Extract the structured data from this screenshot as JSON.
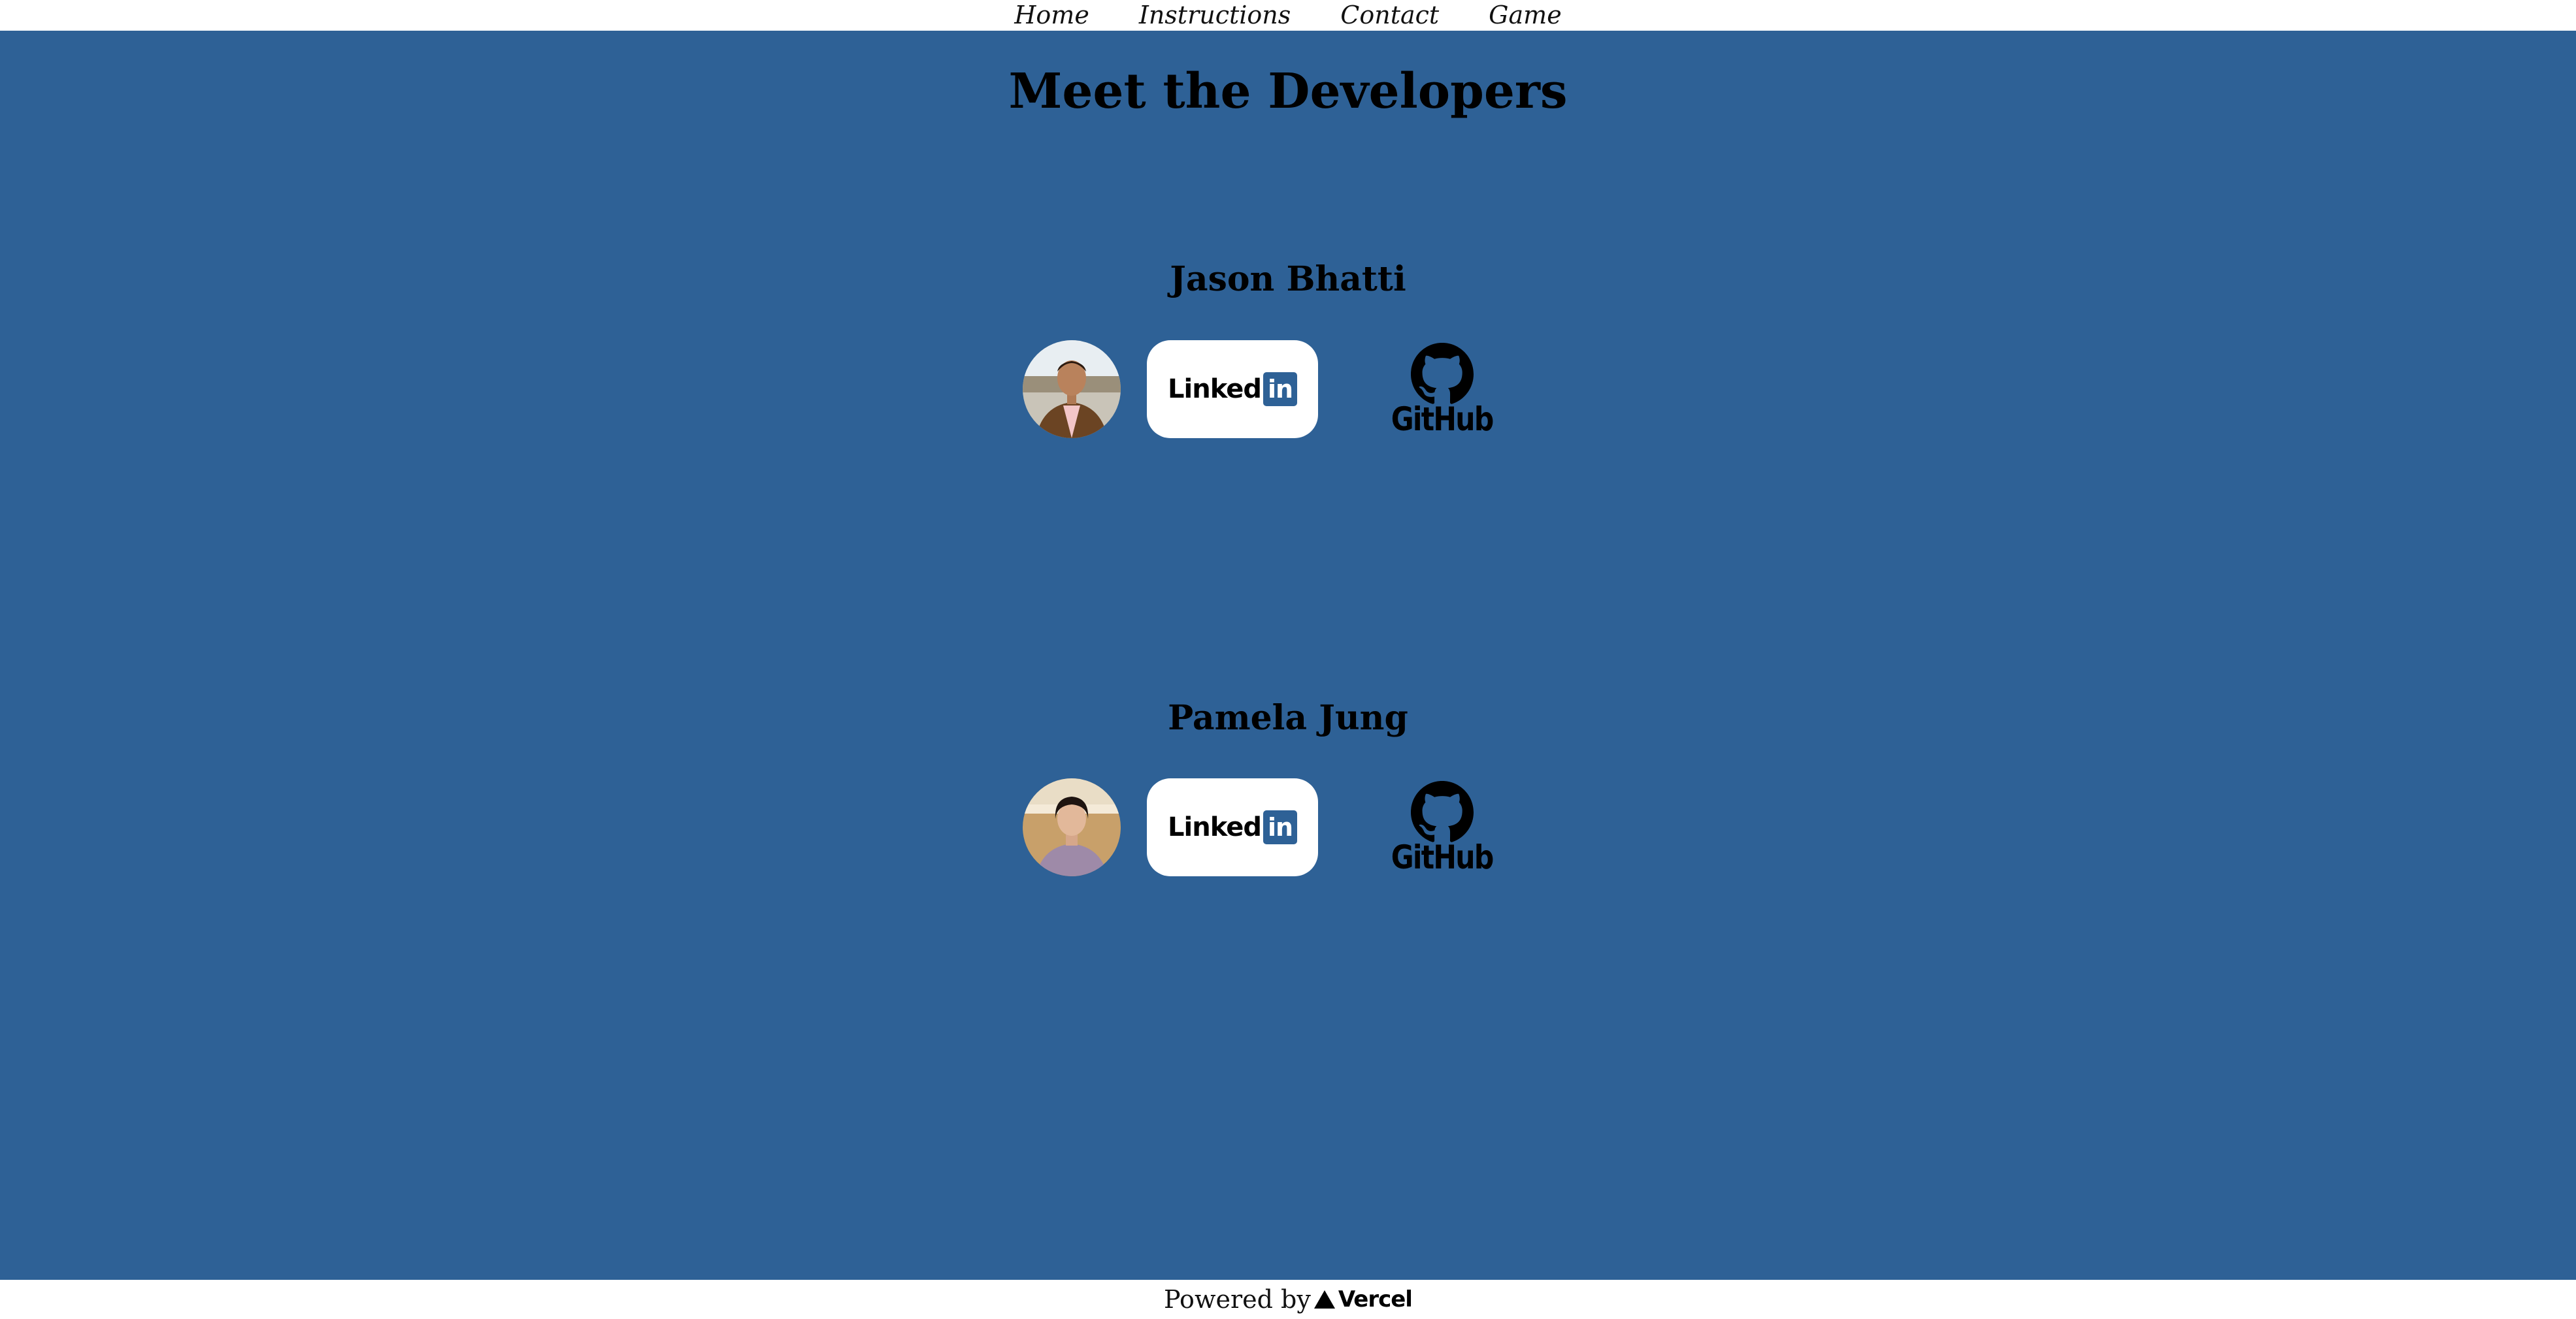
{
  "nav": {
    "items": [
      {
        "label": "Home"
      },
      {
        "label": "Instructions"
      },
      {
        "label": "Contact"
      },
      {
        "label": "Game"
      }
    ]
  },
  "page": {
    "title": "Meet the Developers",
    "background_color": "#2e6196"
  },
  "developers": [
    {
      "name": "Jason Bhatti",
      "avatar_icon": "profile-photo",
      "linkedin": {
        "text": "Linked",
        "badge": "in"
      },
      "github": {
        "text": "GitHub",
        "icon": "github-octocat-icon"
      }
    },
    {
      "name": "Pamela Jung",
      "avatar_icon": "profile-photo",
      "linkedin": {
        "text": "Linked",
        "badge": "in"
      },
      "github": {
        "text": "GitHub",
        "icon": "github-octocat-icon"
      }
    }
  ],
  "footer": {
    "powered_by": "Powered by",
    "brand": "Vercel",
    "brand_icon": "vercel-triangle-icon"
  }
}
